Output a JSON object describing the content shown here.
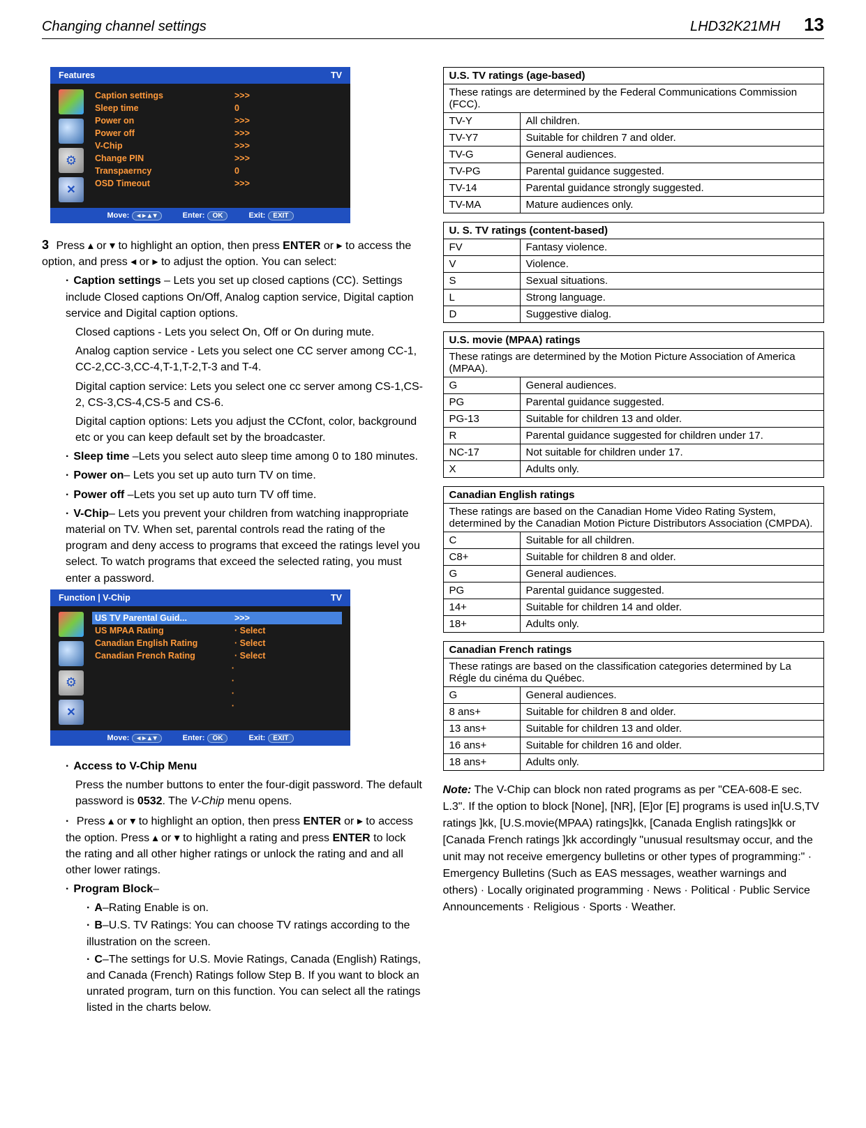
{
  "header": {
    "left": "Changing channel settings",
    "model": "LHD32K21MH",
    "page": "13"
  },
  "osd1": {
    "title_left": "Features",
    "title_right": "TV",
    "items": [
      {
        "label": "Caption settings",
        "val": ">>>"
      },
      {
        "label": "Sleep time",
        "val": "0"
      },
      {
        "label": "Power on",
        "val": ">>>"
      },
      {
        "label": "Power off",
        "val": ">>>"
      },
      {
        "label": "V-Chip",
        "val": ">>>"
      },
      {
        "label": "Change PIN",
        "val": ">>>"
      },
      {
        "label": "Transpaerncy",
        "val": "0"
      },
      {
        "label": "OSD Timeout",
        "val": ">>>"
      }
    ],
    "footer": {
      "move": "Move:",
      "enter": "Enter:",
      "exit": "Exit:",
      "ok": "OK",
      "exitbtn": "EXIT",
      "arrows": "◂ ▸ ▴ ▾"
    }
  },
  "step3": {
    "num": "3",
    "line1a": "Press ▴ or ▾ to highlight an option, then press ",
    "enter": "ENTER",
    "line1b": " or ▸ to access the option, and press ◂ or ▸ to adjust  the option. You can select:",
    "cap_title": "Caption settings",
    "cap_desc": " – Lets you set up closed captions (CC). Settings include Closed captions On/Off, Analog caption service, Digital caption service and Digital caption options.",
    "cap_closed": "Closed captions - Lets you select On, Off or On during mute.",
    "cap_analog": "Analog caption service - Lets you select one CC server among CC-1, CC-2,CC-3,CC-4,T-1,T-2,T-3 and T-4.",
    "cap_digital": "Digital caption service: Lets you select one cc server among CS-1,CS-2, CS-3,CS-4,CS-5 and CS-6.",
    "cap_options": "Digital caption options: Lets you adjust the CCfont, color, background etc or you can keep default set by the broadcaster.",
    "sleep_title": "Sleep time",
    "sleep_desc": " –Lets you select auto sleep time among 0 to 180 minutes.",
    "pon_title": "Power on",
    "pon_desc": "– Lets you set up auto turn TV on time.",
    "poff_title": "Power off",
    "poff_desc": " –Lets you set up auto turn TV off time.",
    "vchip_title": "V-Chip",
    "vchip_desc": "– Lets you prevent your children from watching inappropriate material on TV. When set, parental controls read the rating of the program and deny access to programs that exceed the ratings level you select. To watch programs that exceed the selected rating, you must enter a  password."
  },
  "osd2": {
    "title_left": "Function | V-Chip",
    "title_right": "TV",
    "items": [
      {
        "label": "US TV Parental Guid...",
        "val": ">>>"
      },
      {
        "label": "US MPAA Rating",
        "val": "· Select"
      },
      {
        "label": "Canadian English Rating",
        "val": "· Select"
      },
      {
        "label": "Canadian French Rating",
        "val": "· Select"
      }
    ],
    "footer": {
      "move": "Move:",
      "enter": "Enter:",
      "exit": "Exit:",
      "ok": "OK",
      "exitbtn": "EXIT",
      "arrows": "◂ ▸ ▴ ▾"
    }
  },
  "sec_access": {
    "title": "Access to V-Chip Menu",
    "line1": "Press the number buttons to enter the four-digit password. The default password is ",
    "pw": "0532",
    "line1b": ".  The ",
    "vchip_it": "V-Chip",
    "line1c": " menu opens.",
    "line2a": "Press ▴ or ▾ to highlight an option, then press ",
    "enter": "ENTER",
    "line2b": " or ▸ to access the option. Press ▴ or ▾ to highlight a rating and press  ",
    "enter2": "ENTER",
    "line2c": "   to lock the rating and all other higher ratings or unlock the rating and and all other lower ratings.",
    "pb_title": "Program Block",
    "pb_a": "–Rating Enable is on.",
    "pb_b": "–U.S. TV Ratings: You can choose TV ratings according to the illustration on the screen.",
    "pb_c": "–The settings for U.S. Movie Ratings, Canada (English) Ratings, and Canada (French) Ratings follow Step B. If you want to block an unrated program, turn on this function. You can select all the ratings listed in the charts below."
  },
  "tables": {
    "us_tv": {
      "head": "U.S. TV ratings (age-based)",
      "sub": "These ratings are determined by the Federal Communications Commission (FCC).",
      "rows": [
        [
          "TV-Y",
          "All children."
        ],
        [
          "TV-Y7",
          "Suitable for children 7 and older."
        ],
        [
          "TV-G",
          "General audiences."
        ],
        [
          "TV-PG",
          "Parental guidance suggested."
        ],
        [
          "TV-14",
          "Parental guidance strongly suggested."
        ],
        [
          "TV-MA",
          "Mature audiences only."
        ]
      ]
    },
    "us_tv_content": {
      "head": "U. S. TV ratings (content-based)",
      "rows": [
        [
          "FV",
          "Fantasy violence."
        ],
        [
          "V",
          "Violence."
        ],
        [
          "S",
          "Sexual situations."
        ],
        [
          "L",
          "Strong language."
        ],
        [
          "D",
          "Suggestive dialog."
        ]
      ]
    },
    "mpaa": {
      "head": "U.S. movie (MPAA) ratings",
      "sub": "These ratings are determined by the Motion Picture Association of America (MPAA).",
      "rows": [
        [
          "G",
          "General audiences."
        ],
        [
          "PG",
          "Parental guidance suggested."
        ],
        [
          "PG-13",
          "Suitable for children 13 and older."
        ],
        [
          "R",
          "Parental guidance suggested for children under 17."
        ],
        [
          "NC-17",
          "Not suitable for children under 17."
        ],
        [
          "X",
          "Adults only."
        ]
      ]
    },
    "can_en": {
      "head": "Canadian English ratings",
      "sub": "These ratings are based on the Canadian Home Video Rating System, determined by the Canadian Motion Picture Distributors Association (CMPDA).",
      "rows": [
        [
          "C",
          "Suitable for all children."
        ],
        [
          "C8+",
          "Suitable for children 8 and older."
        ],
        [
          "G",
          "General audiences."
        ],
        [
          "PG",
          "Parental guidance suggested."
        ],
        [
          "14+",
          "Suitable for children 14 and older."
        ],
        [
          "18+",
          "Adults only."
        ]
      ]
    },
    "can_fr": {
      "head": "Canadian French ratings",
      "sub": "These ratings are based on the classification categories determined by La Régle du cinéma du Québec.",
      "rows": [
        [
          "G",
          "General audiences."
        ],
        [
          "8 ans+",
          "Suitable for children 8 and older."
        ],
        [
          "13 ans+",
          "Suitable for children 13 and older."
        ],
        [
          "16 ans+",
          "Suitable for children 16 and older."
        ],
        [
          "18 ans+",
          "Adults only."
        ]
      ]
    }
  },
  "note": {
    "label": "Note:",
    "text": "  The V-Chip can block non rated programs as per \"CEA-608-E sec. L.3\". If the option to block [None], [NR], [E]or [E] programs is used in[U.S,TV ratings ]kk, [U.S.movie(MPAA) ratings]kk, [Canada English ratings]kk or [Canada French ratings ]kk accordingly \"unusual resultsmay occur, and the unit may not receive emergency bulletins or other types of programming:\" · Emergency Bulletins (Such as EAS messages, weather warnings and others) · Locally originated programming · News · Political · Public Service Announcements · Religious · Sports · Weather."
  }
}
